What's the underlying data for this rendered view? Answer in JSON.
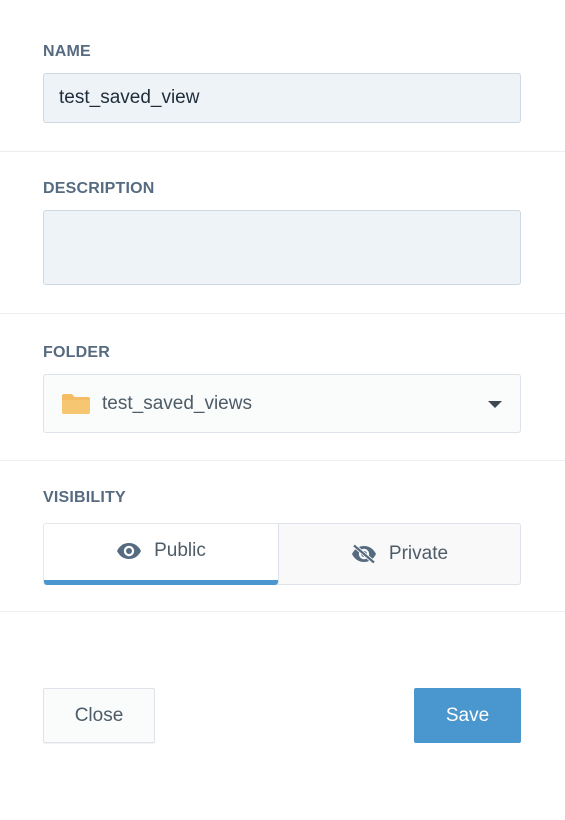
{
  "name_section": {
    "label": "NAME",
    "value": "test_saved_view"
  },
  "description_section": {
    "label": "DESCRIPTION",
    "value": "",
    "placeholder": ""
  },
  "folder_section": {
    "label": "FOLDER",
    "selected": "test_saved_views",
    "icon": "folder-icon",
    "folder_color": "#f5bd63"
  },
  "visibility_section": {
    "label": "VISIBILITY",
    "options": [
      {
        "label": "Public",
        "icon": "eye-icon",
        "selected": true
      },
      {
        "label": "Private",
        "icon": "eye-slash-icon",
        "selected": false
      }
    ],
    "accent_color": "#4a97cf"
  },
  "footer": {
    "close_label": "Close",
    "save_label": "Save",
    "save_color": "#4a97cf"
  }
}
